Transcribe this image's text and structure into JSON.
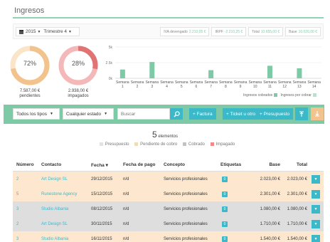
{
  "header": {
    "title": "Ingresos"
  },
  "period": {
    "year": "2015",
    "quarter": "Trimestre 4"
  },
  "tax_pills": [
    {
      "label": "IVA devengado",
      "value": "2.210,05 €"
    },
    {
      "label": "IRPF",
      "value": "-2.210,25 €"
    },
    {
      "label": "Total",
      "value": "10.655,00 €"
    },
    {
      "label": "Base",
      "value": "10.026,00 €"
    }
  ],
  "donuts": [
    {
      "percent": "72%",
      "fraction": 0.72,
      "amount": "7.587,00 €",
      "label": "pendientes",
      "color": "#f2c38d",
      "track": "#fbe4c8"
    },
    {
      "percent": "28%",
      "fraction": 0.28,
      "amount": "2.938,00 €",
      "label": "impagados",
      "color": "#e27373",
      "track": "#f4b8b8"
    }
  ],
  "chart_data": {
    "type": "bar",
    "categories": [
      "Semana 1",
      "Semana 2",
      "Semana 3",
      "Semana 4",
      "Semana 5",
      "Semana 6",
      "Semana 7",
      "Semana 8",
      "Semana 9",
      "Semana 10",
      "Semana 11",
      "Semana 12",
      "Semana 13",
      "Semana 14"
    ],
    "series": [
      {
        "name": "Ingresos cobrados",
        "values": [
          1400,
          0,
          2600,
          0,
          0,
          0,
          1300,
          0,
          0,
          0,
          2000,
          0,
          1600,
          0
        ],
        "color": "#7ec9a6"
      },
      {
        "name": "Ingresos por cobrar",
        "values": [
          0,
          0,
          0,
          0,
          0,
          0,
          0,
          0,
          0,
          0,
          0,
          0,
          0,
          0
        ],
        "color": "#b9e2cc"
      }
    ],
    "ylim": [
      0,
      5000
    ],
    "yticks": [
      "0k",
      "2.5k",
      "5k"
    ],
    "grid": true,
    "legend": "bottom-right"
  },
  "filters": {
    "type": "Todos los tipos",
    "status": "Cualquier estado",
    "search_placeholder": "Buscar"
  },
  "actions": {
    "invoice": "+ Factura",
    "ticket": "+ Ticket u otro",
    "quote": "+ Presupuesto"
  },
  "summary": {
    "count": "5",
    "label": "elementos"
  },
  "status_legend": [
    {
      "label": "Presupuesto",
      "color": "#e3e3e3"
    },
    {
      "label": "Pendiente de cobro",
      "color": "#f8d9b0"
    },
    {
      "label": "Cobrado",
      "color": "#c2c2c2"
    },
    {
      "label": "Impagado",
      "color": "#f08a8a"
    }
  ],
  "table": {
    "columns": [
      "Número",
      "Contacto",
      "Fecha ▾",
      "Fecha de pago",
      "Concepto",
      "Etiquetas",
      "Base",
      "Total"
    ],
    "rows": [
      {
        "num": "2",
        "contact": "Art Design SL",
        "date": "29/12/2015",
        "paid": "n/d",
        "concept": "Servicios profesionales",
        "tag": "0",
        "base": "2.023,00 €",
        "total": "2.023,00 €",
        "bg": "#fde7cf"
      },
      {
        "num": "5",
        "contact": "Runestone Agency",
        "date": "15/12/2015",
        "paid": "n/d",
        "concept": "Servicios profesionales",
        "tag": "0",
        "base": "2.301,00 €",
        "total": "2.301,00 €",
        "bg": "#fde7cf"
      },
      {
        "num": "3",
        "contact": "Studio Albania",
        "date": "08/12/2015",
        "paid": "n/d",
        "concept": "Servicios profesionales",
        "tag": "0",
        "base": "1.080,00 €",
        "total": "1.080,00 €",
        "bg": "#dedede"
      },
      {
        "num": "2",
        "contact": "Art Design SL",
        "date": "30/11/2015",
        "paid": "n/d",
        "concept": "Servicios profesionales",
        "tag": "0",
        "base": "1.710,00 €",
        "total": "1.710,00 €",
        "bg": "#dedede"
      },
      {
        "num": "3",
        "contact": "Studio Albania",
        "date": "16/11/2015",
        "paid": "n/d",
        "concept": "Servicios profesionales",
        "tag": "0",
        "base": "1.540,00 €",
        "total": "1.540,00 €",
        "bg": "#fde7cf"
      }
    ]
  }
}
